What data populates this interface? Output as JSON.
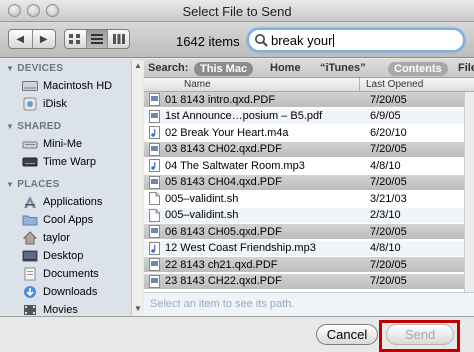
{
  "window": {
    "title": "Select File to Send"
  },
  "toolbar": {
    "nav_back": "◀",
    "nav_forward": "▶",
    "item_count": "1642 items",
    "search_value": "break your"
  },
  "sidebar": {
    "sections": [
      {
        "label": "DEVICES",
        "items": [
          {
            "label": "Macintosh HD",
            "icon": "hard-drive-icon"
          },
          {
            "label": "iDisk",
            "icon": "idisk-icon"
          }
        ]
      },
      {
        "label": "SHARED",
        "items": [
          {
            "label": "Mini-Me",
            "icon": "computer-icon"
          },
          {
            "label": "Time Warp",
            "icon": "network-drive-icon"
          }
        ]
      },
      {
        "label": "PLACES",
        "items": [
          {
            "label": "Applications",
            "icon": "applications-icon"
          },
          {
            "label": "Cool Apps",
            "icon": "folder-icon"
          },
          {
            "label": "taylor",
            "icon": "home-icon"
          },
          {
            "label": "Desktop",
            "icon": "desktop-icon"
          },
          {
            "label": "Documents",
            "icon": "documents-icon"
          },
          {
            "label": "Downloads",
            "icon": "downloads-icon"
          },
          {
            "label": "Movies",
            "icon": "movies-icon"
          }
        ]
      }
    ]
  },
  "search_scope": {
    "label": "Search:",
    "options": [
      "This Mac",
      "Home",
      "“iTunes”"
    ],
    "selected": "This Mac",
    "contents": "Contents",
    "file_name": "File Name"
  },
  "columns": {
    "name": "Name",
    "date": "Last Opened"
  },
  "files": [
    {
      "name": "01 8143 intro.qxd.PDF",
      "date": "7/20/05",
      "type": "pdf",
      "disabled": true
    },
    {
      "name": "1st Announce…posium – B5.pdf",
      "date": "6/9/05",
      "type": "pdf",
      "disabled": false
    },
    {
      "name": "02 Break Your Heart.m4a",
      "date": "6/20/10",
      "type": "audio",
      "disabled": false
    },
    {
      "name": "03 8143 CH02.qxd.PDF",
      "date": "7/20/05",
      "type": "pdf",
      "disabled": true
    },
    {
      "name": "04 The Saltwater Room.mp3",
      "date": "4/8/10",
      "type": "audio",
      "disabled": false
    },
    {
      "name": "05 8143 CH04.qxd.PDF",
      "date": "7/20/05",
      "type": "pdf",
      "disabled": true
    },
    {
      "name": "005–validint.sh",
      "date": "3/21/03",
      "type": "script",
      "disabled": false
    },
    {
      "name": "005–validint.sh",
      "date": "2/3/10",
      "type": "script",
      "disabled": false
    },
    {
      "name": "06 8143 CH05.qxd.PDF",
      "date": "7/20/05",
      "type": "pdf",
      "disabled": true
    },
    {
      "name": "12 West Coast Friendship.mp3",
      "date": "4/8/10",
      "type": "audio",
      "disabled": false
    },
    {
      "name": "22 8143 ch21.qxd.PDF",
      "date": "7/20/05",
      "type": "pdf",
      "disabled": true
    },
    {
      "name": "23 8143 CH22.qxd.PDF",
      "date": "7/20/05",
      "type": "pdf",
      "disabled": true
    }
  ],
  "path_hint": "Select an item to see its path.",
  "buttons": {
    "cancel": "Cancel",
    "send": "Send"
  }
}
